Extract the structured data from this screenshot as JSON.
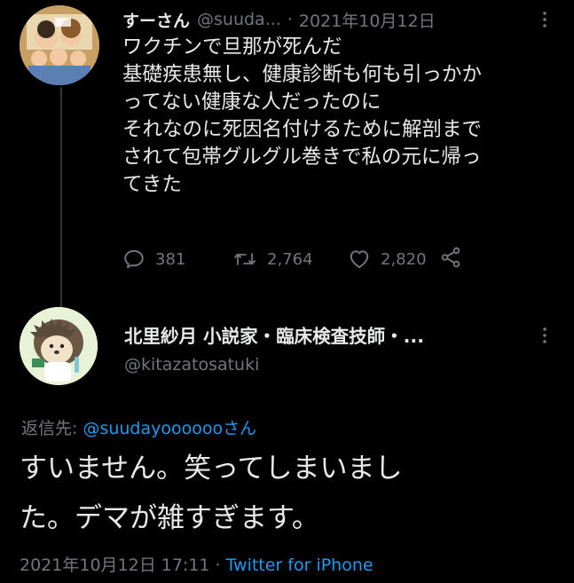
{
  "tweet1": {
    "display_name": "すーさん",
    "handle": "@suuda...",
    "separator": "·",
    "date": "2021年10月12日",
    "body": "ワクチンで旦那が死んだ\n基礎疾患無し、健康診断も何も引っかか\nってない健康な人だったのに\nそれなのに死因名付けるために解剖まで\nされて包帯グルグル巻きで私の元に帰っ\nてきた",
    "replies": "381",
    "retweets": "2,764",
    "likes": "2,820",
    "avatar_icon": "avatar-family-illustration-icon",
    "more_icon": "more-options-icon"
  },
  "tweet2": {
    "display_name": "北里紗月 小説家・臨床検査技師・...",
    "handle": "@kitazatosatuki",
    "avatar_icon": "avatar-hedgehog-illustration-icon",
    "reply_prefix": "返信先: ",
    "reply_to_handle": "@suudayoooooo",
    "reply_suffix": "さん",
    "body": "すいません。笑ってしまいまし\nた。デマが雑すぎます。",
    "timestamp": "2021年10月12日 17:11",
    "separator": "·",
    "source": "Twitter for iPhone"
  },
  "colors": {
    "background": "#000000",
    "text": "#e7e9ea",
    "muted": "#71767b",
    "link": "#1d9bf0",
    "thread_line": "#333639"
  }
}
